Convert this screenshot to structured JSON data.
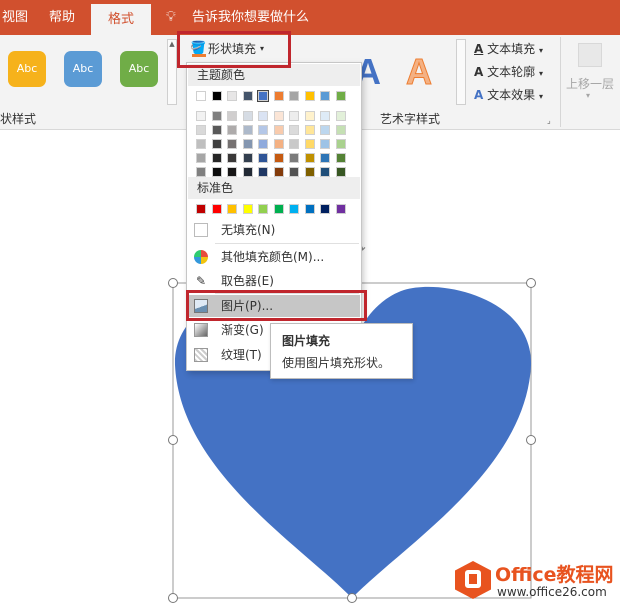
{
  "tabs": {
    "view": "视图",
    "help": "帮助",
    "format": "格式",
    "tell_me": "告诉我你想要做什么"
  },
  "styles": [
    {
      "text": "Abc",
      "color": "#f6b21b"
    },
    {
      "text": "Abc",
      "color": "#5b9bd5"
    },
    {
      "text": "Abc",
      "color": "#70ad47"
    }
  ],
  "group_shape_styles": "状样式",
  "group_wordart": "艺术字样式",
  "shape_fill_label": "形状填充",
  "wordart": {
    "a1": "A",
    "a2": "A"
  },
  "text_fill": "文本填充",
  "text_outline": "文本轮廓",
  "text_effects": "文本效果",
  "move_up": "上移一层",
  "menu": {
    "theme_colors": "主题颜色",
    "standard_colors": "标准色",
    "no_fill": "无填充(N)",
    "more_colors": "其他填充颜色(M)...",
    "eyedropper": "取色器(E)",
    "picture": "图片(P)...",
    "gradient": "渐变(G)",
    "texture": "纹理(T)"
  },
  "theme_columns": [
    [
      "#ffffff",
      "#f2f2f2",
      "#d9d9d9",
      "#bfbfbf",
      "#a6a6a6",
      "#808080"
    ],
    [
      "#000000",
      "#7f7f7f",
      "#595959",
      "#404040",
      "#262626",
      "#0d0d0d"
    ],
    [
      "#e7e6e6",
      "#d0cece",
      "#aeabab",
      "#757171",
      "#3a3838",
      "#171616"
    ],
    [
      "#44546a",
      "#d6dce4",
      "#adb9ca",
      "#8496b0",
      "#333f4f",
      "#222a35"
    ],
    [
      "#4472c4",
      "#dae3f3",
      "#b4c7e7",
      "#8faadc",
      "#2f5597",
      "#203864"
    ],
    [
      "#ed7d31",
      "#fbe5d6",
      "#f8cbad",
      "#f4b183",
      "#c55a11",
      "#843c0c"
    ],
    [
      "#a5a5a5",
      "#ededed",
      "#dbdbdb",
      "#c9c9c9",
      "#7b7b7b",
      "#525252"
    ],
    [
      "#ffc000",
      "#fff2cc",
      "#ffe699",
      "#ffd966",
      "#bf9000",
      "#7f6000"
    ],
    [
      "#5b9bd5",
      "#deebf7",
      "#bdd7ee",
      "#9dc3e6",
      "#2e75b6",
      "#1f4e79"
    ],
    [
      "#70ad47",
      "#e2f0d9",
      "#c5e0b4",
      "#a9d18e",
      "#548235",
      "#385723"
    ]
  ],
  "standard": [
    "#c00000",
    "#ff0000",
    "#ffc000",
    "#ffff00",
    "#92d050",
    "#00b050",
    "#00b0f0",
    "#0070c0",
    "#002060",
    "#7030a0"
  ],
  "tooltip": {
    "title": "图片填充",
    "desc": "使用图片填充形状。"
  },
  "heart_color": "#4472c4",
  "watermark": {
    "brand": "Office教程网",
    "url": "www.office26.com"
  }
}
